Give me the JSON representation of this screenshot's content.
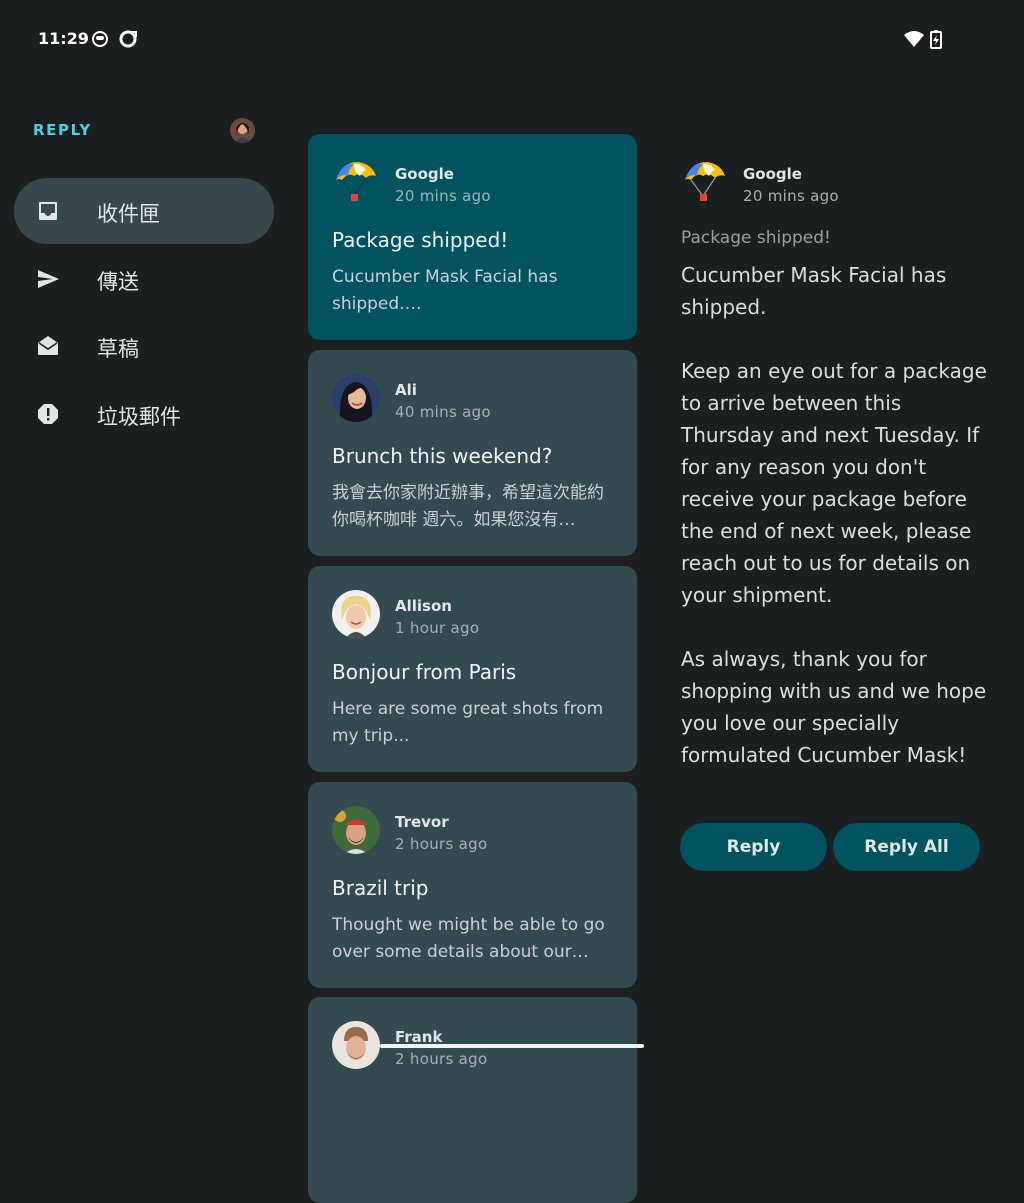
{
  "status_bar": {
    "time": "11:29"
  },
  "nav": {
    "brand": "REPLY",
    "items": [
      {
        "label": "收件匣",
        "icon": "inbox-icon",
        "active": true
      },
      {
        "label": "傳送",
        "icon": "send-icon",
        "active": false
      },
      {
        "label": "草稿",
        "icon": "drafts-icon",
        "active": false
      },
      {
        "label": "垃圾郵件",
        "icon": "report-icon",
        "active": false
      }
    ]
  },
  "emails": [
    {
      "sender": "Google",
      "time": "20 mins ago",
      "subject": "Package shipped!",
      "preview": "Cucumber Mask Facial has shipped.…"
    },
    {
      "sender": "Ali",
      "time": "40 mins ago",
      "subject": "Brunch this weekend?",
      "preview": "我會去你家附近辦事，希望這次能約你喝杯咖啡 週六。如果您沒有…"
    },
    {
      "sender": "Allison",
      "time": "1 hour ago",
      "subject": "Bonjour from Paris",
      "preview": "Here are some great shots from my trip..."
    },
    {
      "sender": "Trevor",
      "time": "2 hours ago",
      "subject": "Brazil trip",
      "preview": "Thought we might be able to go over some details about our upc…"
    },
    {
      "sender": "Frank",
      "time": "2 hours ago",
      "subject": "",
      "preview": ""
    }
  ],
  "detail": {
    "sender": "Google",
    "time": "20 mins ago",
    "subject": "Package shipped!",
    "body": [
      "Cucumber Mask Facial has shipped.",
      "Keep an eye out for a package to arrive between this Thursday and next Tuesday. If for any reason you don't receive your package before the end of next week, please reach out to us for details on your shipment.",
      "As always, thank you for shopping with us and we hope you love our specially formulated Cucumber Mask!"
    ],
    "reply_label": "Reply",
    "reply_all_label": "Reply All"
  },
  "colors": {
    "background": "#1b1f20",
    "card": "#334a50",
    "selected_card": "#00535f",
    "accent": "#4dd0e1",
    "button": "#00535f"
  }
}
